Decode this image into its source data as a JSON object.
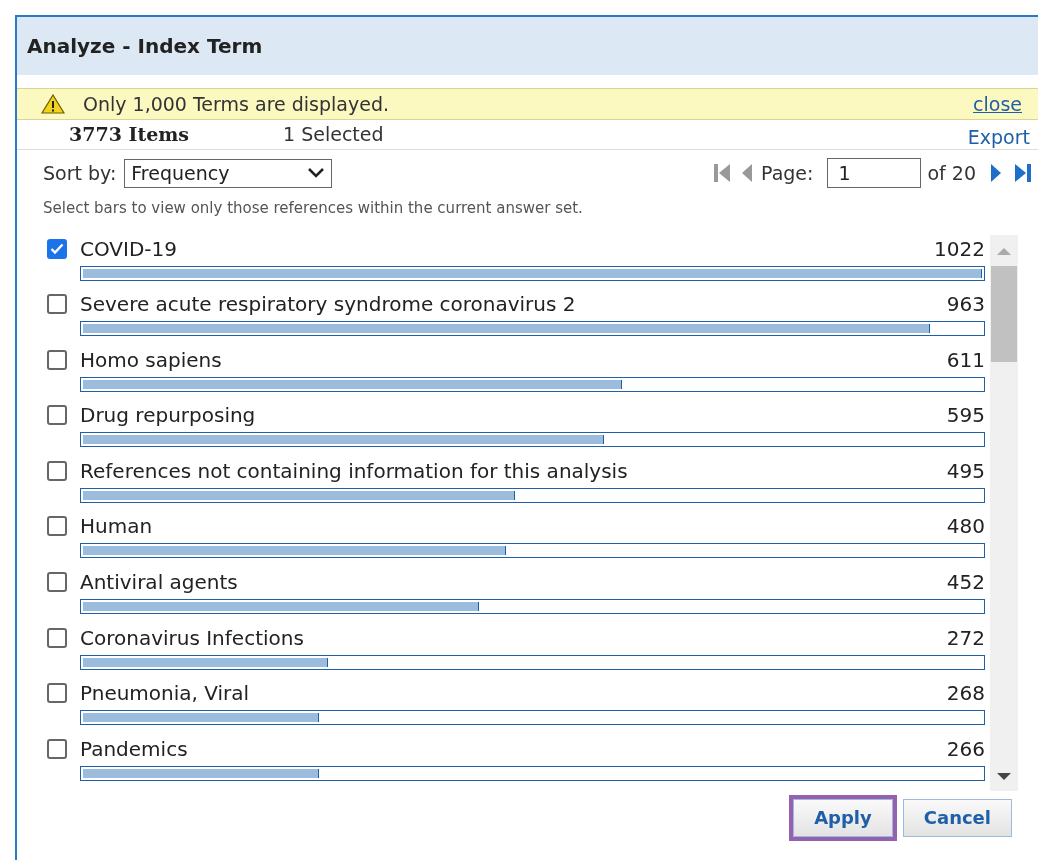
{
  "dialog": {
    "title": "Analyze - Index Term"
  },
  "warning": {
    "message": "Only 1,000 Terms are displayed.",
    "close": "close"
  },
  "summary": {
    "items": "3773 Items",
    "selected": "1 Selected",
    "export": "Export"
  },
  "sort": {
    "label": "Sort by:",
    "value": "Frequency"
  },
  "pager": {
    "label": "Page:",
    "value": "1",
    "of": "of 20"
  },
  "hint": "Select bars to view only those references within the current answer set.",
  "terms": [
    {
      "label": "COVID-19",
      "count": "1022",
      "checked": true,
      "level": 1.0
    },
    {
      "label": "Severe acute respiratory syndrome coronavirus 2",
      "count": "963",
      "checked": false,
      "level": 0.942
    },
    {
      "label": "Homo sapiens",
      "count": "611",
      "checked": false,
      "level": 0.6
    },
    {
      "label": "Drug repurposing",
      "count": "595",
      "checked": false,
      "level": 0.58
    },
    {
      "label": "References not containing information for this analysis",
      "count": "495",
      "checked": false,
      "level": 0.48
    },
    {
      "label": "Human",
      "count": "480",
      "checked": false,
      "level": 0.47
    },
    {
      "label": "Antiviral agents",
      "count": "452",
      "checked": false,
      "level": 0.44
    },
    {
      "label": "Coronavirus Infections",
      "count": "272",
      "checked": false,
      "level": 0.272
    },
    {
      "label": "Pneumonia, Viral",
      "count": "268",
      "checked": false,
      "level": 0.262
    },
    {
      "label": "Pandemics",
      "count": "266",
      "checked": false,
      "level": 0.262
    }
  ],
  "buttons": [
    {
      "label": "Apply",
      "highlighted": true
    },
    {
      "label": "Cancel",
      "highlighted": false
    }
  ]
}
